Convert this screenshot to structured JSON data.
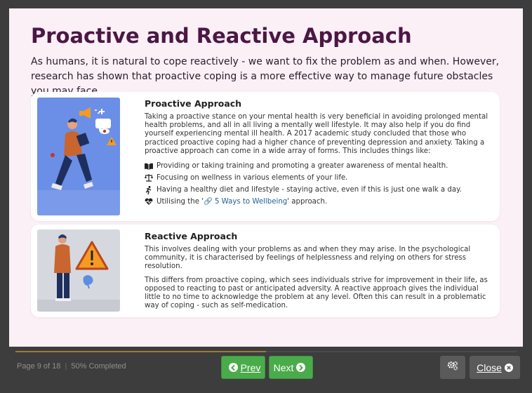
{
  "slide": {
    "title": "Proactive and Reactive Approach",
    "intro": "As humans, it is natural to cope reactively - we want to fix the problem as and when. However, research has shown that proactive coping is a more effective way to manage future obstacles you may face."
  },
  "proactive": {
    "title": "Proactive Approach",
    "text": "Taking a proactive stance on your mental health is very beneficial in avoiding prolonged mental health problems, and all in all living a mentally well lifestyle. It may also help if you do find yourself experiencing mental ill health. A 2017 academic study concluded that those who practiced proactive coping had a higher chance of preventing depression and anxiety. Taking a proactive approach can come in a wide array of forms. This includes things like:",
    "bullets": [
      {
        "icon": "book-icon",
        "text": "Providing or taking training and promoting a greater awareness of mental health."
      },
      {
        "icon": "balance-scale-icon",
        "text": "Focusing on wellness in various elements of your life."
      },
      {
        "icon": "running-icon",
        "text": "Having a healthy diet and lifestyle - staying active, even if this is just one walk a day."
      }
    ],
    "last_bullet": {
      "icon": "heartbeat-icon",
      "prefix": "Utilising the '",
      "link": "5 Ways to Wellbeing",
      "suffix": "' approach."
    }
  },
  "reactive": {
    "title": "Reactive Approach",
    "text1": "This involves dealing with your problems as and when they may arise. In the psychological community, it is characterised by feelings of helplessness and relying on others for stress resolution.",
    "text2": "This differs from proactive coping, which sees individuals strive for improvement in their life, as opposed to reacting to past or anticipated adversity. A reactive approach gives the individual little to no time to acknowledge the problem at any level. Often this can result in a problematic way of coping - such as self-medication."
  },
  "footer": {
    "page": "Page 9 of 18",
    "separator": "|",
    "completed": "50% Completed",
    "progress_percent": 50,
    "prev_label": "Prev",
    "next_label": "Next",
    "close_label": "Close"
  },
  "colors": {
    "title": "#4b1744",
    "button_green": "#4aab4a",
    "button_dark": "#5a5a5a",
    "slide_bg": "#faf0f6"
  }
}
